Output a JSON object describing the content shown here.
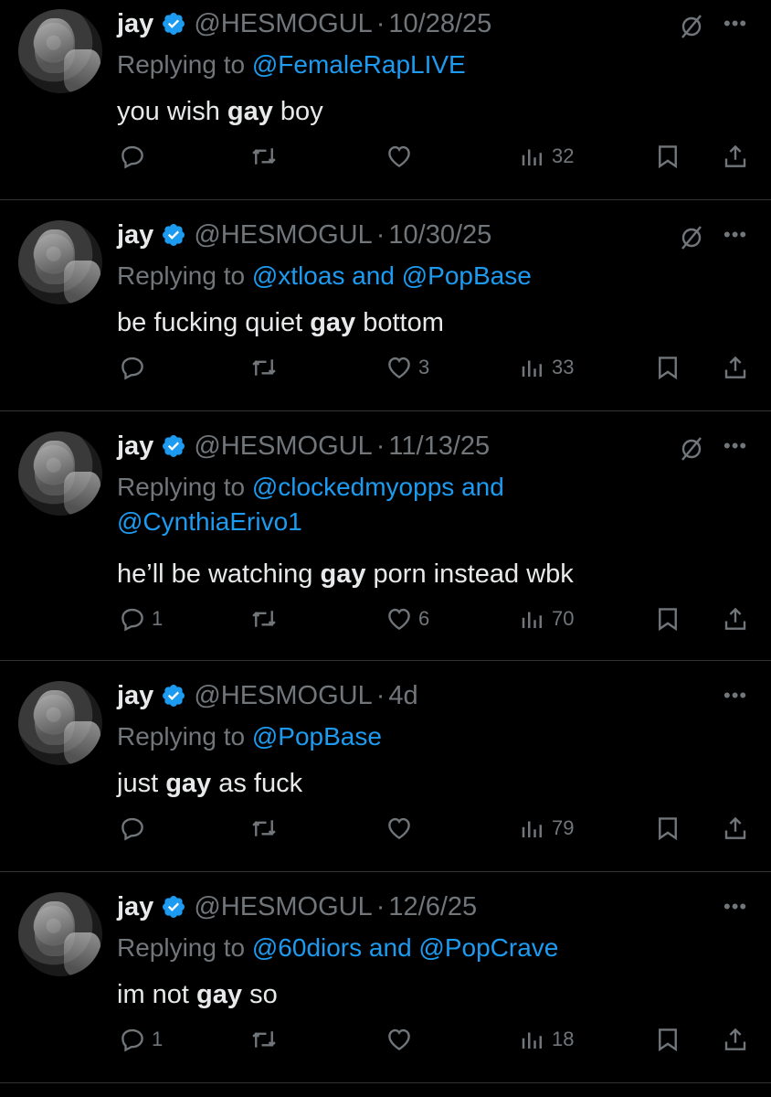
{
  "user": {
    "name": "jay",
    "handle": "@HESMOGUL",
    "separator": "·"
  },
  "colors": {
    "background": "#000000",
    "text": "#e7e9ea",
    "muted": "#71767b",
    "accent": "#1d9bf0",
    "divider": "#2f3336"
  },
  "tweets": [
    {
      "time": "10/28/25",
      "replying_prefix": "Replying to",
      "replying_to": [
        {
          "text": "@FemaleRapLIVE"
        }
      ],
      "text_before": "you wish ",
      "text_bold": "gay",
      "text_after": " boy",
      "replies": "",
      "likes": "",
      "views": "32",
      "grok_icon": true
    },
    {
      "time": "10/30/25",
      "replying_prefix": "Replying to",
      "replying_to": [
        {
          "text": "@xtloas"
        },
        {
          "text": "@PopBase"
        }
      ],
      "and": "and",
      "text_before": "be fucking quiet ",
      "text_bold": "gay",
      "text_after": " bottom",
      "replies": "",
      "likes": "3",
      "views": "33",
      "grok_icon": true
    },
    {
      "time": "11/13/25",
      "replying_prefix": "Replying to",
      "replying_to": [
        {
          "text": "@clockedmyopps"
        },
        {
          "text": "@CynthiaErivo1"
        }
      ],
      "and": "and",
      "text_before": "he’ll be watching ",
      "text_bold": "gay",
      "text_after": " porn instead wbk",
      "replies": "1",
      "likes": "6",
      "views": "70",
      "grok_icon": true
    },
    {
      "time": "4d",
      "replying_prefix": "Replying to",
      "replying_to": [
        {
          "text": "@PopBase"
        }
      ],
      "text_before": "just ",
      "text_bold": "gay",
      "text_after": " as fuck",
      "replies": "",
      "likes": "",
      "views": "79",
      "grok_icon": false
    },
    {
      "time": "12/6/25",
      "replying_prefix": "Replying to",
      "replying_to": [
        {
          "text": "@60diors"
        },
        {
          "text": "@PopCrave"
        }
      ],
      "and": "and",
      "text_before": "im not ",
      "text_bold": "gay",
      "text_after": " so",
      "replies": "1",
      "likes": "",
      "views": "18",
      "grok_icon": false
    }
  ],
  "icons": [
    "verified-badge-icon",
    "grok-icon",
    "more-icon",
    "reply-icon",
    "retweet-icon",
    "like-icon",
    "views-icon",
    "bookmark-icon",
    "share-icon"
  ]
}
